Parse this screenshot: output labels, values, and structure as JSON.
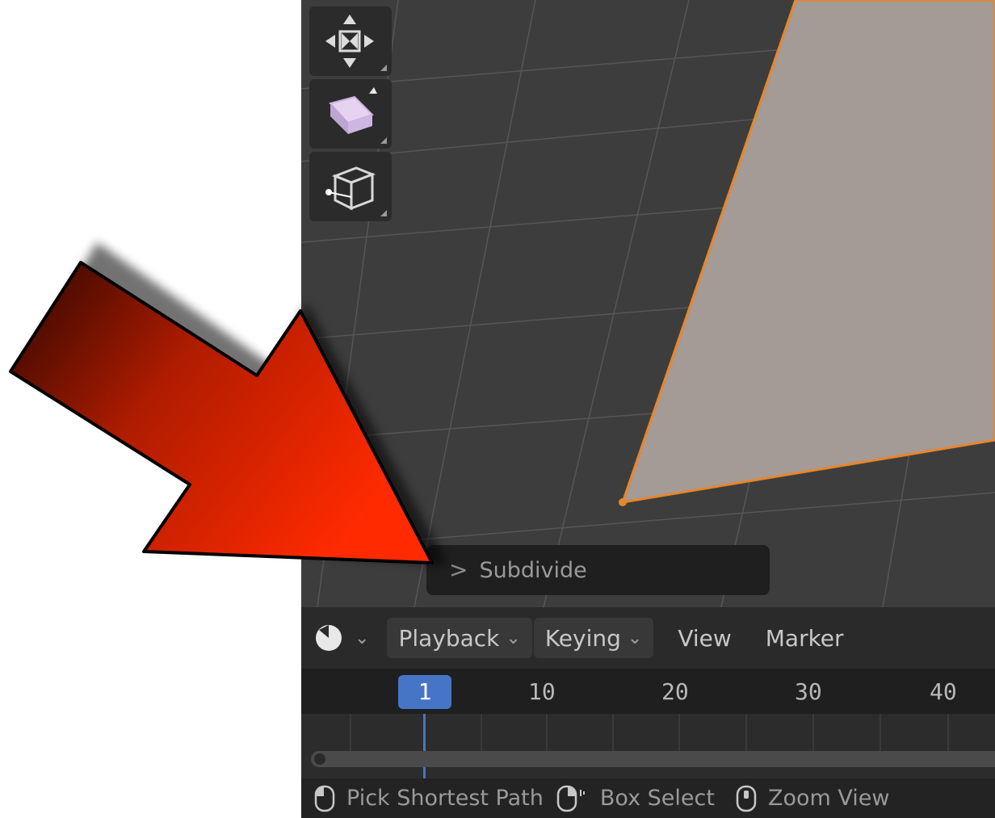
{
  "toolbar": {
    "tools": [
      {
        "icon": "move-icon"
      },
      {
        "icon": "extrude-icon"
      },
      {
        "icon": "loop-cut-icon"
      }
    ]
  },
  "redo_panel": {
    "label": "Subdivide",
    "chevron": ">"
  },
  "timeline": {
    "editor_type_icon": "clock-icon",
    "menus": {
      "playback": "Playback",
      "keying": "Keying",
      "view": "View",
      "marker": "Marker"
    },
    "current_frame": "1",
    "frame_ticks": [
      "10",
      "20",
      "30",
      "40"
    ]
  },
  "status_bar": {
    "items": [
      {
        "icon": "mouse-left-icon",
        "label": "Pick Shortest Path"
      },
      {
        "icon": "mouse-right-icon",
        "label": "Box Select"
      },
      {
        "icon": "mouse-middle-icon",
        "label": "Zoom View"
      }
    ]
  },
  "colors": {
    "viewport_bg": "#3d3d3d",
    "face": "#a49a96",
    "selection_edge": "#e8862a",
    "frame_accent": "#4675c7",
    "arrow_red": "#ff2a00"
  }
}
